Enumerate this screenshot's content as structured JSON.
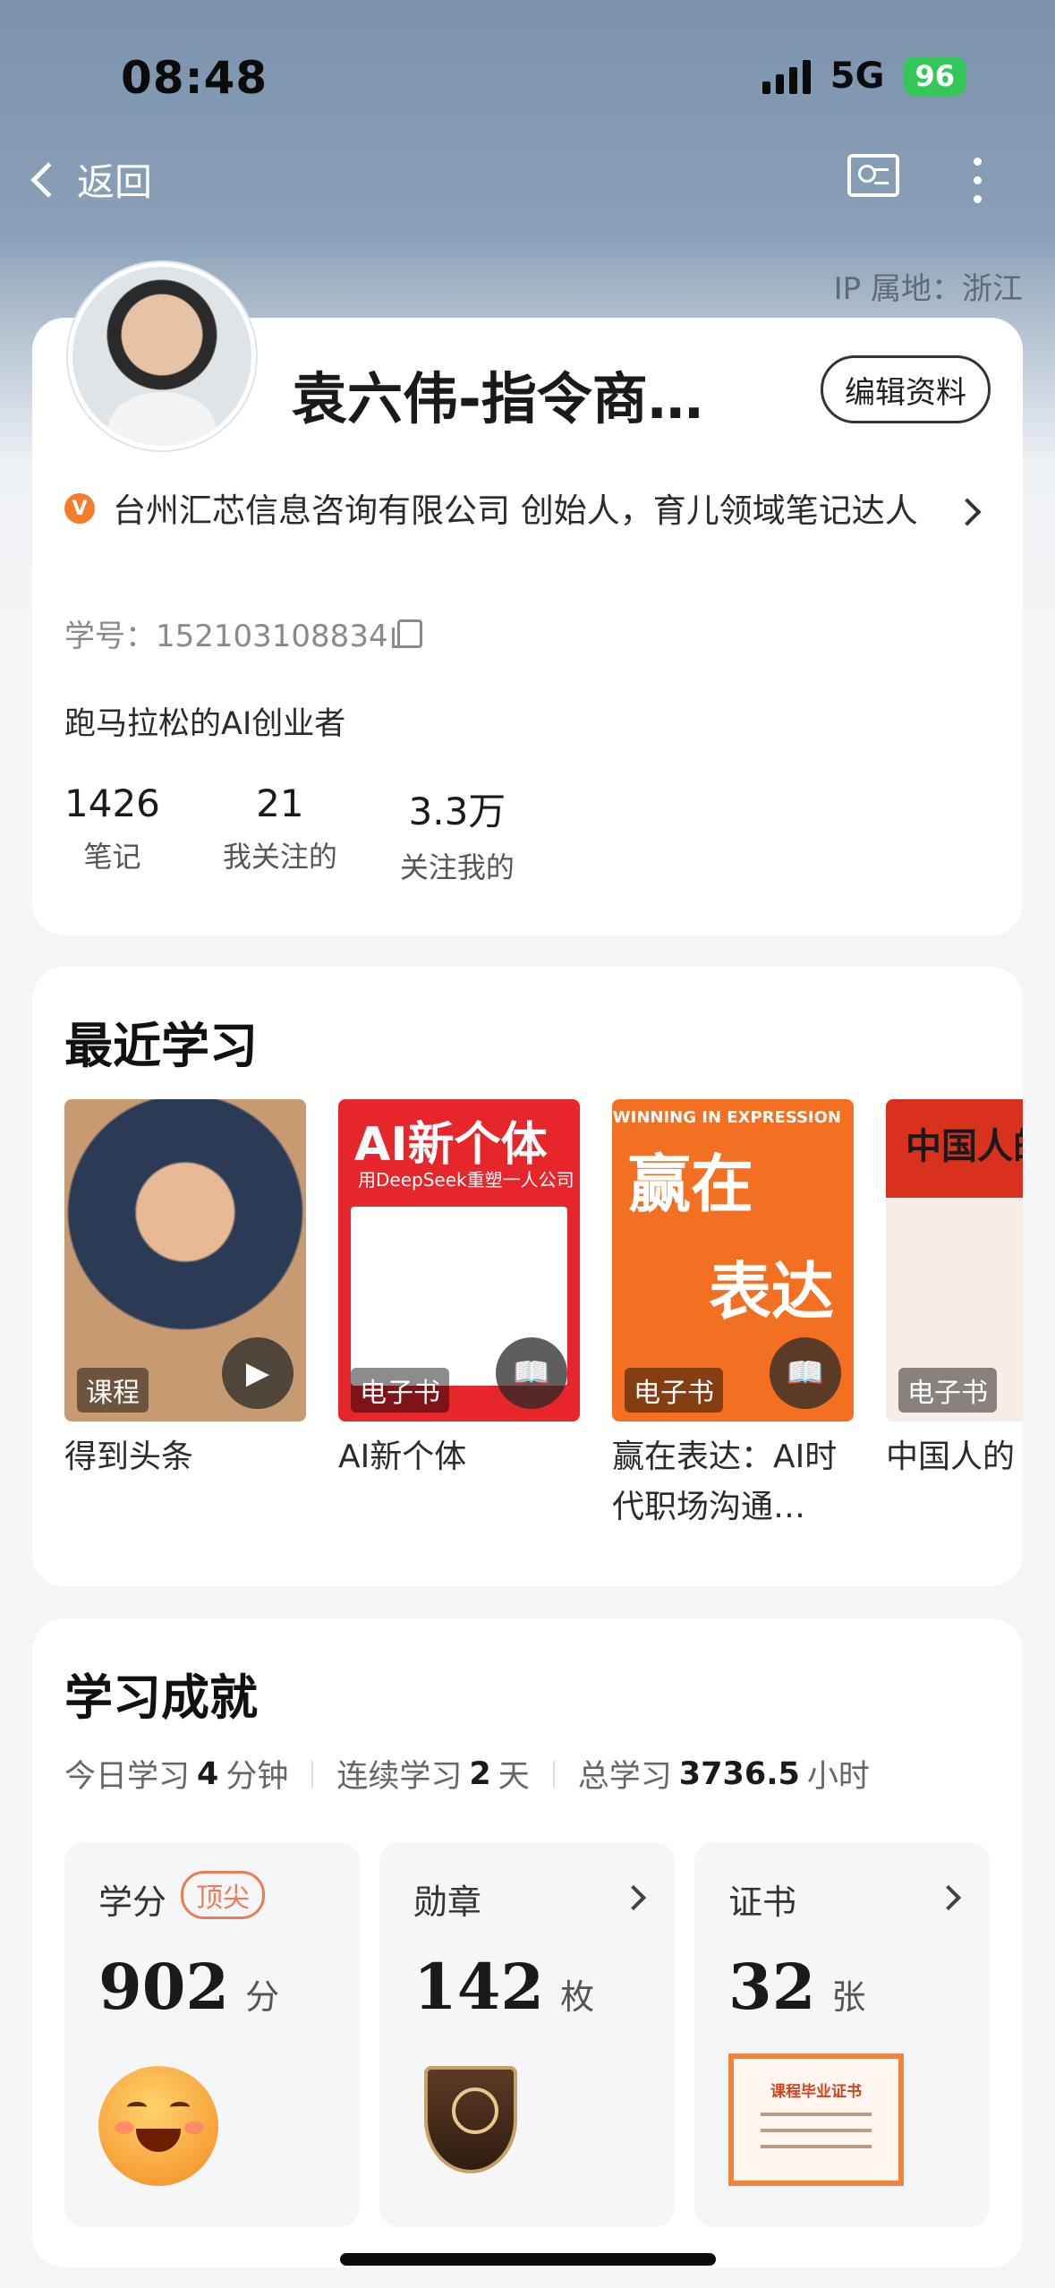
{
  "status_bar": {
    "time": "08:48",
    "network": "5G",
    "battery": "96"
  },
  "nav": {
    "back_label": "返回"
  },
  "ip_location": "IP 属地：浙江",
  "profile": {
    "name": "袁六伟-指令商…",
    "edit_label": "编辑资料",
    "verification": "台州汇芯信息咨询有限公司 创始人，育儿领域笔记达人",
    "student_id": "学号：152103108834",
    "bio": "跑马拉松的AI创业者",
    "stats": [
      {
        "value": "1426",
        "label": "笔记"
      },
      {
        "value": "21",
        "label": "我关注的"
      },
      {
        "value": "3.3万",
        "label": "关注我的"
      }
    ]
  },
  "recent": {
    "title": "最近学习",
    "items": [
      {
        "tag": "课程",
        "title": "得到头条"
      },
      {
        "tag": "电子书",
        "title": "AI新个体",
        "cover_title": "AI新个体",
        "cover_subtitle": "用DeepSeek重塑一人公司"
      },
      {
        "tag": "电子书",
        "title": "赢在表达：AI时代职场沟通…",
        "cover_title_a": "赢在",
        "cover_title_b": "表达",
        "cover_english": "WINNING IN EXPRESSION"
      },
      {
        "tag": "电子书",
        "title": "中国人的",
        "cover_title": "中国人的"
      }
    ]
  },
  "achievements": {
    "title": "学习成就",
    "today_label": "今日学习",
    "today_value": "4",
    "today_unit": "分钟",
    "streak_label": "连续学习",
    "streak_value": "2",
    "streak_unit": "天",
    "total_label": "总学习",
    "total_value": "3736.5",
    "total_unit": "小时",
    "tiles": [
      {
        "label": "学分",
        "badge": "顶尖",
        "value": "902",
        "unit": "分"
      },
      {
        "label": "勋章",
        "value": "142",
        "unit": "枚"
      },
      {
        "label": "证书",
        "value": "32",
        "unit": "张",
        "cert_title": "课程毕业证书"
      }
    ]
  },
  "colors": {
    "accent": "#f47c2b",
    "battery": "#34c759",
    "badge": "#f07a56"
  }
}
